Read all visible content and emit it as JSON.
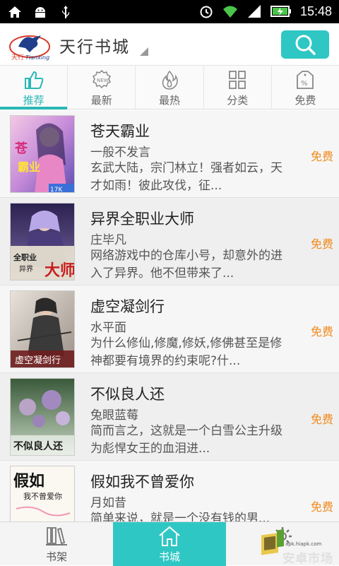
{
  "status_bar": {
    "time": "15:48",
    "icons": [
      "home-icon",
      "android-icon",
      "usb-icon",
      "alarm-icon",
      "wifi-icon",
      "signal-icon",
      "battery-icon"
    ]
  },
  "header": {
    "logo_text": "天行 Tianxing",
    "title": "天行书城",
    "search_icon": "search-icon",
    "accent_color": "#2ec7c4"
  },
  "tabs": [
    {
      "label": "推荐",
      "icon": "thumbs-up-icon",
      "active": true
    },
    {
      "label": "最新",
      "icon": "new-badge-icon",
      "active": false
    },
    {
      "label": "最热",
      "icon": "flame-icon",
      "active": false
    },
    {
      "label": "分类",
      "icon": "grid-icon",
      "active": false
    },
    {
      "label": "免费",
      "icon": "percent-tag-icon",
      "active": false
    }
  ],
  "books": [
    {
      "title": "苍天霸业",
      "author": "一般不发言",
      "desc": "玄武大陆，宗门林立！强者如云，天才如雨！彼此攻伐，征...",
      "badge": "免费",
      "cover_text": "苍天霸业"
    },
    {
      "title": "异界全职业大师",
      "author": "庄毕凡",
      "desc": "网络游戏中的仓库小号，却意外的进入了异界。他不但带来了...",
      "badge": "免费",
      "cover_text": "全职业大师"
    },
    {
      "title": "虚空凝剑行",
      "author": "水平面",
      "desc": "为什么修仙,修魔,修妖,修佛甚至是修神都要有境界的约束呢?什...",
      "badge": "免费",
      "cover_text": "虚空凝剑行"
    },
    {
      "title": "不似良人还",
      "author": "兔眼蓝莓",
      "desc": "简而言之，这就是一个白雪公主升级为彪悍女王的血泪进...",
      "badge": "免费",
      "cover_text": "不似良人还"
    },
    {
      "title": "假如我不曾爱你",
      "author": "月如昔",
      "desc": "简单来说，就是一个没有钱的男...",
      "badge": "免费",
      "cover_text": "假如我不曾爱你"
    }
  ],
  "bottom_nav": [
    {
      "label": "书架",
      "icon": "bookshelf-icon",
      "active": false
    },
    {
      "label": "书城",
      "icon": "house-icon",
      "active": true
    },
    {
      "label": "",
      "icon": "gear-icon",
      "active": false
    }
  ],
  "watermark": {
    "url": "apk.hiapk.com",
    "brand": "安卓市场"
  },
  "colors": {
    "accent": "#2ec7c4",
    "free_badge": "#f08a1c"
  }
}
